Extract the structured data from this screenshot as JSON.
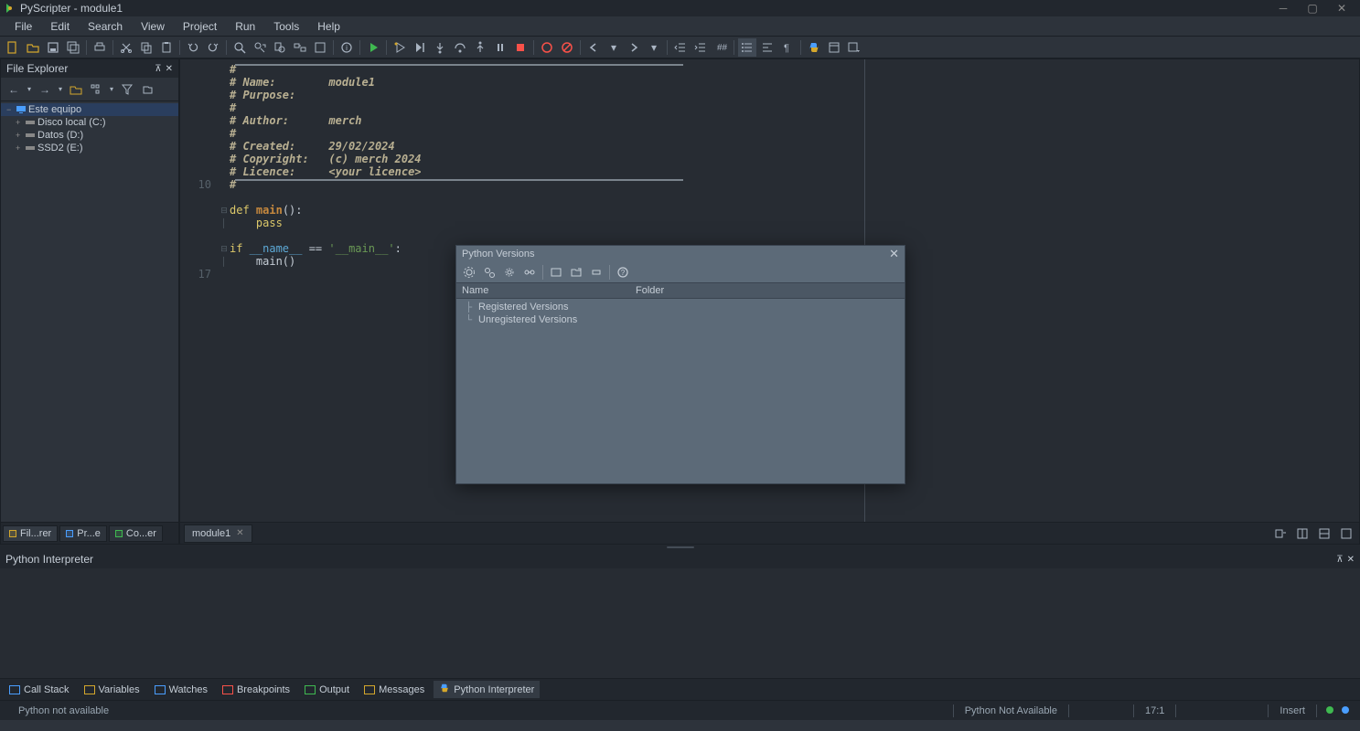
{
  "titlebar": {
    "title": "PyScripter - module1"
  },
  "menu": {
    "items": [
      "File",
      "Edit",
      "Search",
      "View",
      "Project",
      "Run",
      "Tools",
      "Help"
    ]
  },
  "file_explorer": {
    "title": "File Explorer",
    "tree": {
      "root": "Este equipo",
      "children": [
        {
          "label": "Disco local (C:)"
        },
        {
          "label": "Datos (D:)"
        },
        {
          "label": "SSD2 (E:)"
        }
      ]
    },
    "tabs": [
      {
        "label": "Fil...rer"
      },
      {
        "label": "Pr...e"
      },
      {
        "label": "Co...er"
      }
    ]
  },
  "editor": {
    "tab": "module1",
    "line_numbers": [
      "",
      "",
      "",
      "",
      "",
      "",
      "",
      "",
      "",
      "10",
      "",
      "",
      "",
      "",
      "",
      "",
      "17"
    ],
    "code": {
      "l1": "#",
      "l2_label": "# Name:",
      "l2_val": "        module1",
      "l3": "# Purpose:",
      "l4": "#",
      "l5_label": "# Author:",
      "l5_val": "      merch",
      "l6": "#",
      "l7_label": "# Created:",
      "l7_val": "     29/02/2024",
      "l8_label": "# Copyright:",
      "l8_val": "   (c) merch 2024",
      "l9_label": "# Licence:",
      "l9_val": "     <your licence>",
      "l10": "#",
      "def": "def",
      "main_name": "main",
      "defc": "():",
      "pass": "pass",
      "if": "if",
      "name_dunder": " __name__ ",
      "eq": "== ",
      "main_str": "'__main__'",
      "colon": ":",
      "call": "main()"
    }
  },
  "interpreter": {
    "title": "Python Interpreter",
    "tabs": [
      {
        "label": "Call Stack"
      },
      {
        "label": "Variables"
      },
      {
        "label": "Watches"
      },
      {
        "label": "Breakpoints"
      },
      {
        "label": "Output"
      },
      {
        "label": "Messages"
      },
      {
        "label": "Python Interpreter"
      }
    ]
  },
  "status": {
    "msg": "Python not available",
    "py": "Python Not Available",
    "pos": "17:1",
    "mode": "Insert"
  },
  "dialog": {
    "title": "Python Versions",
    "cols": {
      "name": "Name",
      "folder": "Folder"
    },
    "items": {
      "reg": "Registered Versions",
      "unreg": "Unregistered Versions"
    }
  }
}
